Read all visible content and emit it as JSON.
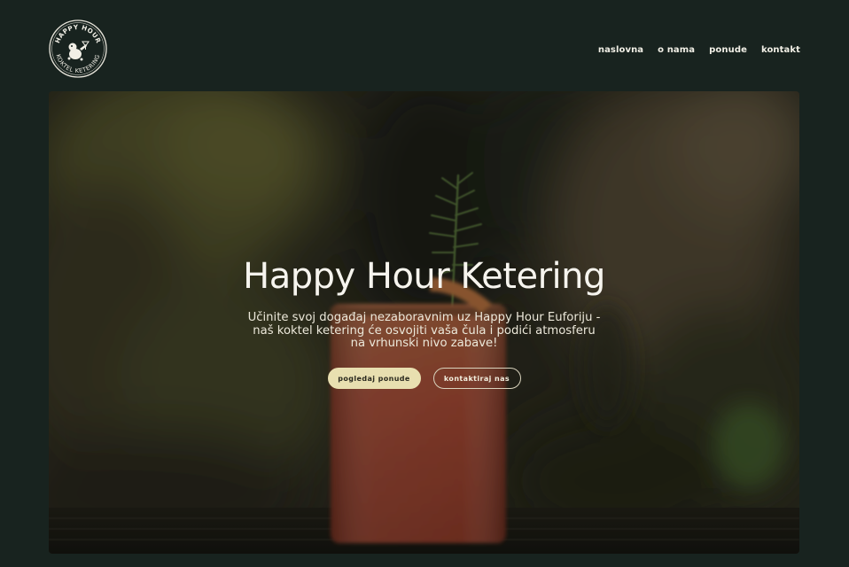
{
  "header": {
    "logo": {
      "top_text": "HAPPY HOUR",
      "bottom_text": "KOKTEL KETERING",
      "icon": "happy-hour-badge-logo"
    },
    "nav": [
      {
        "label": "naslovna"
      },
      {
        "label": "o nama"
      },
      {
        "label": "ponude"
      },
      {
        "label": "kontakt"
      }
    ]
  },
  "hero": {
    "title": "Happy Hour Ketering",
    "subtitle": "Učinite svoj događaj nezaboravnim uz Happy Hour Euforiju - naš koktel ketering će osvojiti vaša čula i podići atmosferu na vrhunski nivo zabave!",
    "background": "blurred cocktail photo with rosemary garnish",
    "buttons": {
      "primary": "pogledaj ponude",
      "secondary": "kontaktiraj nas"
    }
  },
  "colors": {
    "background": "#18231f",
    "text": "#f1efe6",
    "primary_button": "#e8dfb0",
    "cocktail": "#c0553a"
  }
}
